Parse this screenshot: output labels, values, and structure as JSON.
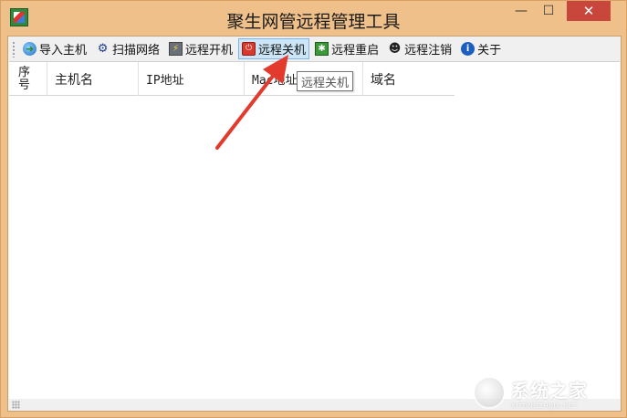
{
  "window": {
    "title": "聚生网管远程管理工具",
    "minimize_glyph": "—",
    "maximize_glyph": "☐",
    "close_glyph": "✕"
  },
  "toolbar": {
    "items": [
      {
        "label": "导入主机",
        "icon": "globe-import-icon"
      },
      {
        "label": "扫描网络",
        "icon": "network-scan-icon"
      },
      {
        "label": "远程开机",
        "icon": "power-on-icon"
      },
      {
        "label": "远程关机",
        "icon": "shutdown-icon",
        "state": "hover"
      },
      {
        "label": "远程重启",
        "icon": "restart-icon"
      },
      {
        "label": "远程注销",
        "icon": "logoff-icon"
      },
      {
        "label": "关于",
        "icon": "info-icon"
      }
    ]
  },
  "table": {
    "columns": [
      "序号",
      "主机名",
      "IP地址",
      "Mac地址",
      "域名"
    ],
    "rows": []
  },
  "tooltip": {
    "text": "远程关机"
  },
  "watermark": {
    "text": "系统之家",
    "sub": "XITONGZHIJIA.NET"
  },
  "colors": {
    "frame": "#f0c08a",
    "close_button": "#c9463d",
    "hover_highlight": "#cde6f7",
    "arrow": "#e23b2e"
  }
}
